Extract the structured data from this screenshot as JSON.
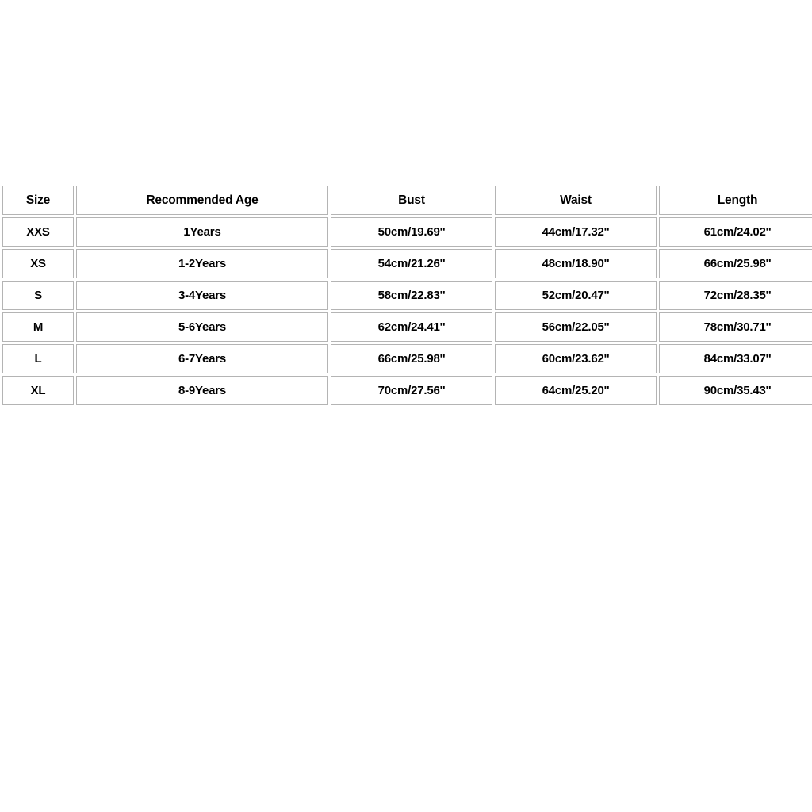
{
  "page": {
    "background_color": "#ffffff",
    "text_color": "#000000",
    "border_color": "#b4b4b4"
  },
  "size_chart": {
    "columns": [
      {
        "key": "size",
        "label": "Size"
      },
      {
        "key": "age",
        "label": "Recommended Age"
      },
      {
        "key": "bust",
        "label": "Bust"
      },
      {
        "key": "waist",
        "label": "Waist"
      },
      {
        "key": "length",
        "label": "Length"
      }
    ],
    "rows": [
      {
        "size": "XXS",
        "age": "1Years",
        "bust": "50cm/19.69''",
        "waist": "44cm/17.32''",
        "length": "61cm/24.02''"
      },
      {
        "size": "XS",
        "age": "1-2Years",
        "bust": "54cm/21.26''",
        "waist": "48cm/18.90''",
        "length": "66cm/25.98''"
      },
      {
        "size": "S",
        "age": "3-4Years",
        "bust": "58cm/22.83''",
        "waist": "52cm/20.47''",
        "length": "72cm/28.35''"
      },
      {
        "size": "M",
        "age": "5-6Years",
        "bust": "62cm/24.41''",
        "waist": "56cm/22.05''",
        "length": "78cm/30.71''"
      },
      {
        "size": "L",
        "age": "6-7Years",
        "bust": "66cm/25.98''",
        "waist": "60cm/23.62''",
        "length": "84cm/33.07''"
      },
      {
        "size": "XL",
        "age": "8-9Years",
        "bust": "70cm/27.56''",
        "waist": "64cm/25.20''",
        "length": "90cm/35.43''"
      }
    ]
  },
  "chart_data": {
    "type": "table",
    "title": "",
    "columns": [
      "Size",
      "Recommended Age",
      "Bust",
      "Waist",
      "Length"
    ],
    "rows": [
      [
        "XXS",
        "1Years",
        "50cm/19.69''",
        "44cm/17.32''",
        "61cm/24.02''"
      ],
      [
        "XS",
        "1-2Years",
        "54cm/21.26''",
        "48cm/18.90''",
        "66cm/25.98''"
      ],
      [
        "S",
        "3-4Years",
        "58cm/22.83''",
        "52cm/20.47''",
        "72cm/28.35''"
      ],
      [
        "M",
        "5-6Years",
        "62cm/24.41''",
        "56cm/22.05''",
        "78cm/30.71''"
      ],
      [
        "L",
        "6-7Years",
        "66cm/25.98''",
        "60cm/23.62''",
        "84cm/33.07''"
      ],
      [
        "XL",
        "8-9Years",
        "70cm/27.56''",
        "64cm/25.20''",
        "90cm/35.43''"
      ]
    ],
    "bust_cm": [
      50,
      54,
      58,
      62,
      66,
      70
    ],
    "bust_in": [
      19.69,
      21.26,
      22.83,
      24.41,
      25.98,
      27.56
    ],
    "waist_cm": [
      44,
      48,
      52,
      56,
      60,
      64
    ],
    "waist_in": [
      17.32,
      18.9,
      20.47,
      22.05,
      23.62,
      25.2
    ],
    "length_cm": [
      61,
      66,
      72,
      78,
      84,
      90
    ],
    "length_in": [
      24.02,
      25.98,
      28.35,
      30.71,
      33.07,
      35.43
    ]
  }
}
